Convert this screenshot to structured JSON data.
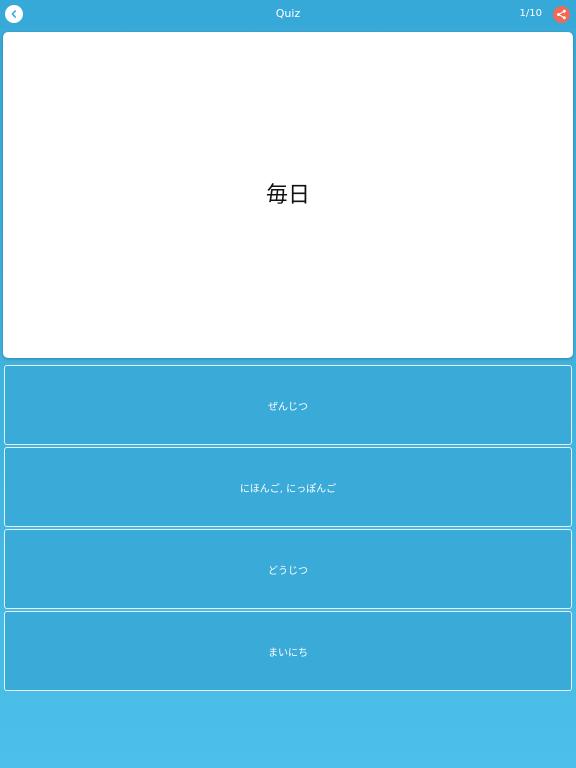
{
  "header": {
    "title": "Quiz",
    "counter": "1/10",
    "back_icon": "chevron-left-icon",
    "share_icon": "share-icon",
    "share_color": "#f06a57",
    "bar_color": "#37a9d8"
  },
  "card": {
    "word": "毎日"
  },
  "options": [
    {
      "label": "ぜんじつ"
    },
    {
      "label": "にほんご, にっぽんご"
    },
    {
      "label": "どうじつ"
    },
    {
      "label": "まいにち"
    }
  ]
}
